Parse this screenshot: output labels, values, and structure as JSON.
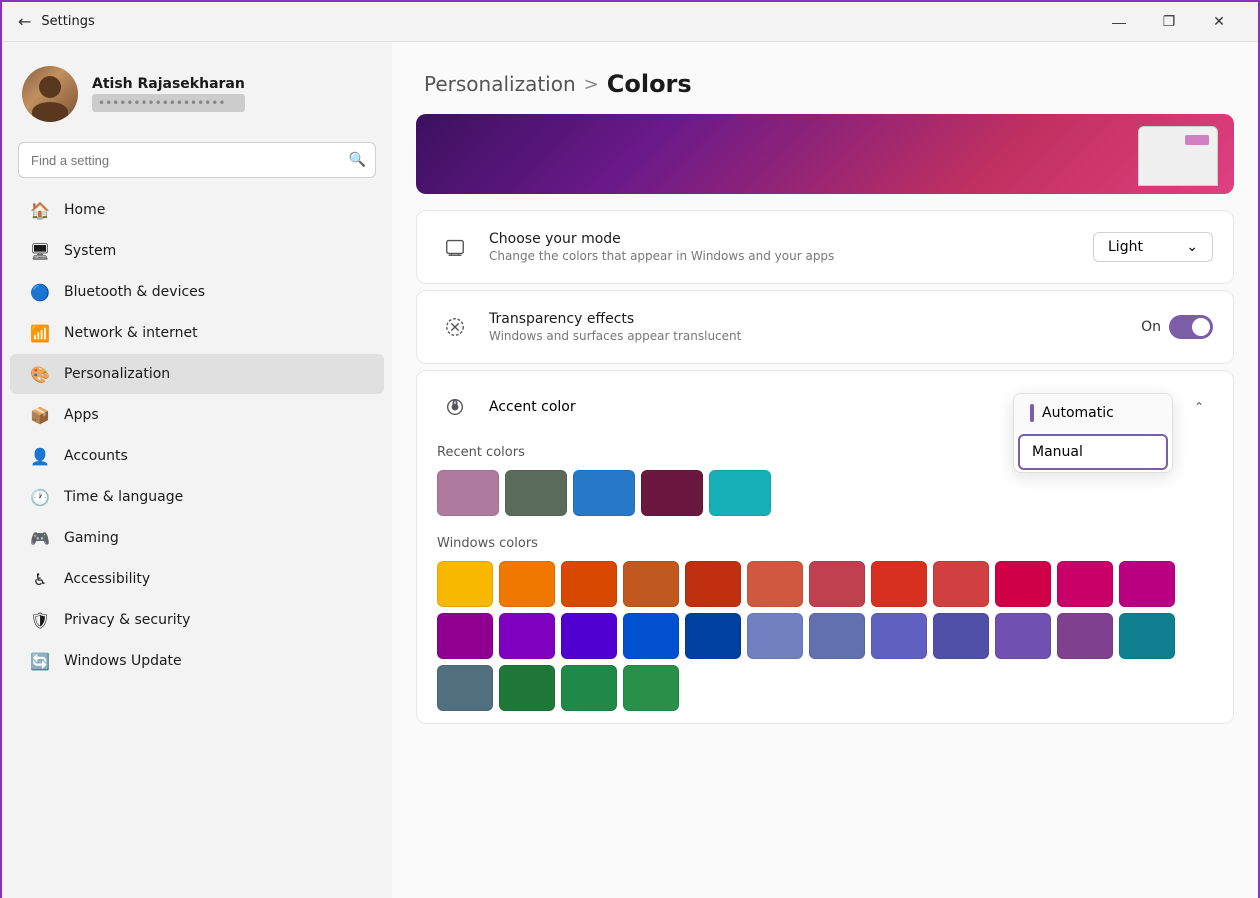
{
  "window": {
    "title": "Settings",
    "controls": {
      "minimize": "—",
      "maximize": "❐",
      "close": "✕"
    }
  },
  "sidebar": {
    "user": {
      "name": "Atish Rajasekharan",
      "email": "••••••••••••••••••"
    },
    "search": {
      "placeholder": "Find a setting"
    },
    "nav": [
      {
        "id": "home",
        "label": "Home",
        "icon": "🏠"
      },
      {
        "id": "system",
        "label": "System",
        "icon": "🖥"
      },
      {
        "id": "bluetooth",
        "label": "Bluetooth & devices",
        "icon": "🔵"
      },
      {
        "id": "network",
        "label": "Network & internet",
        "icon": "📶"
      },
      {
        "id": "personalization",
        "label": "Personalization",
        "icon": "🎨",
        "active": true
      },
      {
        "id": "apps",
        "label": "Apps",
        "icon": "📦"
      },
      {
        "id": "accounts",
        "label": "Accounts",
        "icon": "👤"
      },
      {
        "id": "time",
        "label": "Time & language",
        "icon": "🕐"
      },
      {
        "id": "gaming",
        "label": "Gaming",
        "icon": "🎮"
      },
      {
        "id": "accessibility",
        "label": "Accessibility",
        "icon": "♿"
      },
      {
        "id": "privacy",
        "label": "Privacy & security",
        "icon": "🛡"
      },
      {
        "id": "update",
        "label": "Windows Update",
        "icon": "🔄"
      }
    ]
  },
  "main": {
    "breadcrumb": {
      "parent": "Personalization",
      "separator": ">",
      "current": "Colors"
    },
    "choose_mode": {
      "title": "Choose your mode",
      "subtitle": "Change the colors that appear in Windows and your apps",
      "value": "Light"
    },
    "transparency": {
      "title": "Transparency effects",
      "subtitle": "Windows and surfaces appear translucent",
      "value": "On"
    },
    "accent_color": {
      "title": "Accent color",
      "dropdown_options": [
        "Automatic",
        "Manual"
      ],
      "selected_option": "Manual",
      "popup_items": [
        {
          "label": "Automatic",
          "has_indicator": true
        },
        {
          "label": "Manual",
          "selected": true
        }
      ]
    },
    "recent_colors": {
      "label": "Recent colors",
      "swatches": [
        "#b07a9e",
        "#5a6b5a",
        "#2878c8",
        "#6b1840",
        "#18b0b8"
      ]
    },
    "windows_colors": {
      "label": "Windows colors",
      "swatches": [
        "#f8b800",
        "#f07800",
        "#d84800",
        "#c05820",
        "#c03010",
        "#d05840",
        "#c04050",
        "#d83020",
        "#d04040",
        "#d00048",
        "#c80068",
        "#b80080",
        "#900090",
        "#8000c0",
        "#5000d0",
        "#0050d0",
        "#0040a0",
        "#7080c0",
        "#6070b0",
        "#6060c0",
        "#5050a8",
        "#7050b0",
        "#804090",
        "#108090",
        "#507080",
        "#207838",
        "#208848",
        "#289048"
      ]
    }
  }
}
